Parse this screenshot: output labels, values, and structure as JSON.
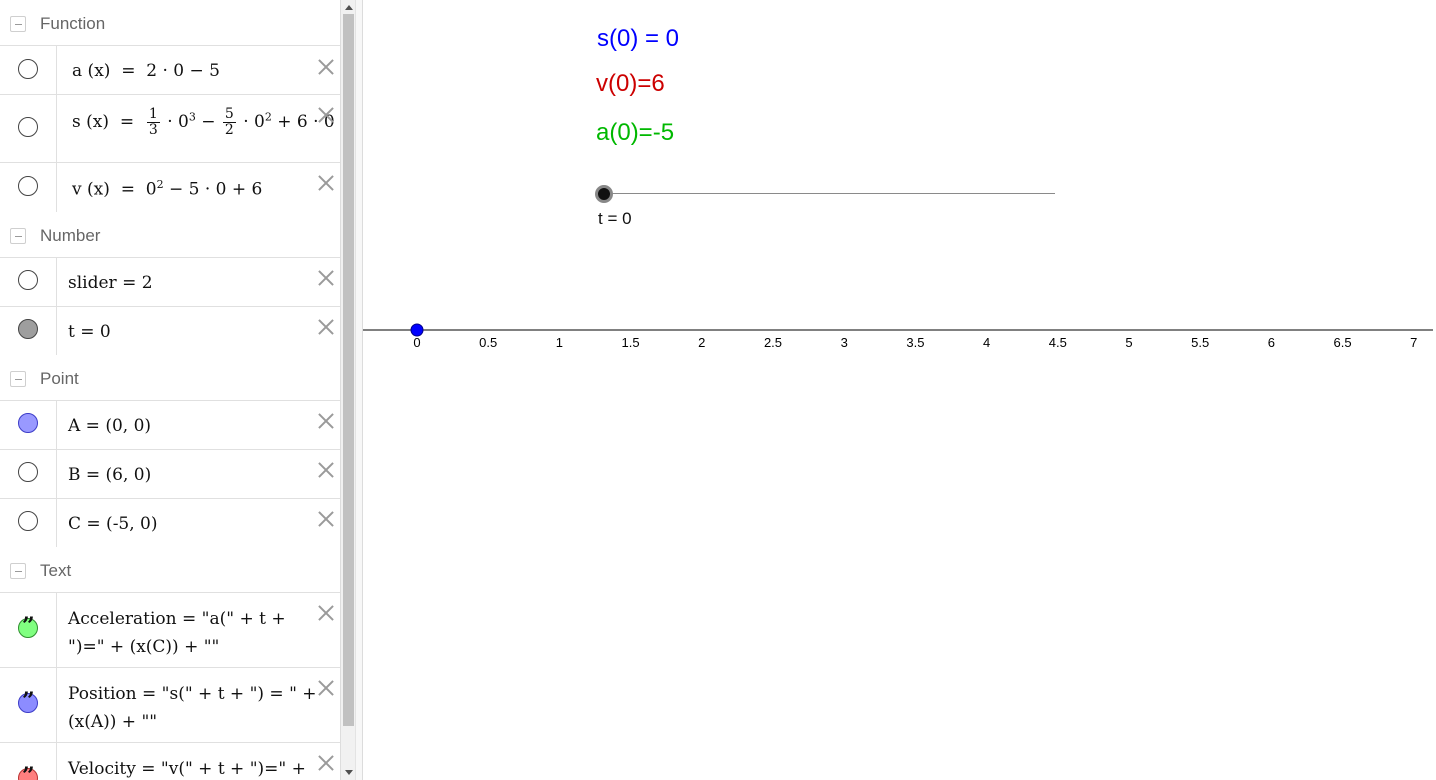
{
  "algebra": {
    "groups": {
      "function": "Function",
      "number": "Number",
      "point": "Point",
      "text": "Text"
    },
    "functions": {
      "a": {
        "name": "a",
        "arg": "x",
        "expr": "2 · 0 − 5"
      },
      "s": {
        "name": "s",
        "arg": "x",
        "frac1_num": "1",
        "frac1_den": "3",
        "mid1": "· 0",
        "exp1": "3",
        "minus": "−",
        "frac2_num": "5",
        "frac2_den": "2",
        "mid2": "· 0",
        "exp2": "2",
        "tail": "+ 6 · 0"
      },
      "v": {
        "name": "v",
        "arg": "x",
        "base": "0",
        "exp": "2",
        "tail": "− 5 · 0 + 6"
      }
    },
    "numbers": {
      "slider": "slider = 2",
      "t": "t = 0"
    },
    "points": {
      "A": "A = (0, 0)",
      "B": "B = (6, 0)",
      "C": "C = (-5, 0)"
    },
    "texts": {
      "acceleration": "Acceleration = \"a(\" + t + \")=\" + (x(C)) + \"\"",
      "position": "Position = \"s(\" + t + \") = \" + (x(A)) + \"\"",
      "velocity": "Velocity = \"v(\" + t + \")=\" + (x(B)) + \"\""
    }
  },
  "graphics": {
    "position_text": "s(0) = 0",
    "velocity_text": "v(0)=6",
    "acceleration_text": "a(0)=-5",
    "slider_caption": "t = 0",
    "colors": {
      "position": "#0000ff",
      "velocity": "#cc0000",
      "acceleration": "#00b800",
      "point": "#0000ff"
    },
    "axis": {
      "tick_labels": [
        "0",
        "0.5",
        "1",
        "1.5",
        "2",
        "2.5",
        "3",
        "3.5",
        "4",
        "4.5",
        "5",
        "5.5",
        "6",
        "6.5",
        "7"
      ],
      "point_A_x": 0
    }
  }
}
